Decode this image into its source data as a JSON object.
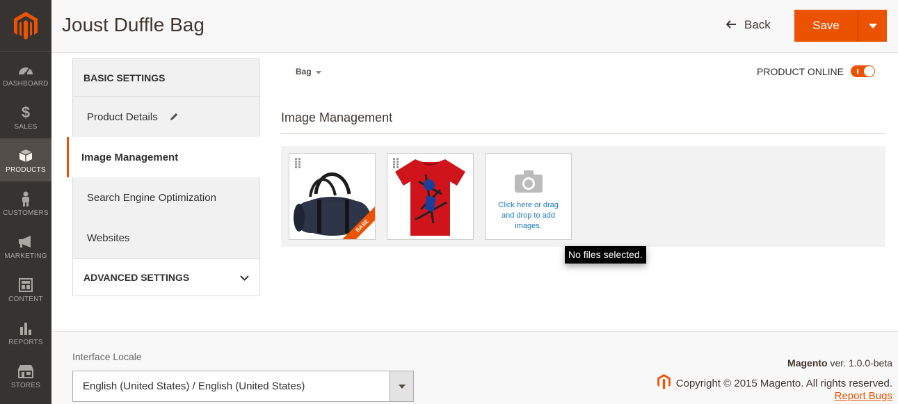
{
  "nav": {
    "items": [
      {
        "label": "DASHBOARD",
        "icon": "dashboard-icon"
      },
      {
        "label": "SALES",
        "icon": "dollar-icon"
      },
      {
        "label": "PRODUCTS",
        "icon": "box-icon"
      },
      {
        "label": "CUSTOMERS",
        "icon": "person-icon"
      },
      {
        "label": "MARKETING",
        "icon": "megaphone-icon"
      },
      {
        "label": "CONTENT",
        "icon": "layout-icon"
      },
      {
        "label": "REPORTS",
        "icon": "bar-chart-icon"
      },
      {
        "label": "STORES",
        "icon": "store-icon"
      }
    ]
  },
  "header": {
    "title": "Joust Duffle Bag",
    "back_label": "Back",
    "save_label": "Save"
  },
  "sidebar": {
    "basic_settings": "BASIC SETTINGS",
    "items": [
      {
        "label": "Product Details"
      },
      {
        "label": "Image Management"
      },
      {
        "label": "Search Engine Optimization"
      },
      {
        "label": "Websites"
      }
    ],
    "advanced_settings": "ADVANCED SETTINGS"
  },
  "main": {
    "attribute_set": "Bag",
    "product_online_label": "PRODUCT ONLINE",
    "product_online": true,
    "section_title": "Image Management",
    "images": [
      {
        "name": "duffle-bag",
        "badge": "BASE"
      },
      {
        "name": "spiderman-tshirt",
        "badge": ""
      }
    ],
    "upload_text": "Click here or drag and drop to add images.",
    "tooltip": "No files selected."
  },
  "footer": {
    "locale_label": "Interface Locale",
    "locale_value": "English (United States) / English (United States)",
    "brand": "Magento",
    "version": " ver. 1.0.0-beta",
    "copyright": "Copyright © 2015 Magento. All rights reserved.",
    "report_bugs": "Report Bugs"
  },
  "colors": {
    "accent": "#eb5202",
    "nav_bg": "#373330",
    "link": "#1979c3"
  }
}
